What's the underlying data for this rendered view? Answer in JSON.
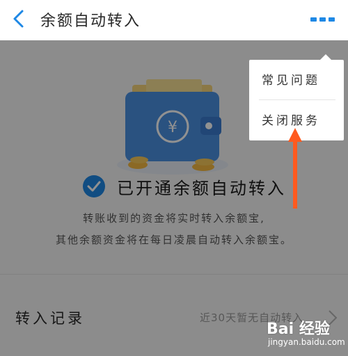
{
  "header": {
    "title": "余额自动转入",
    "back_icon": "chevron-left-icon",
    "more_icon": "more-dots-icon",
    "accent_color": "#1e88e5"
  },
  "main": {
    "status_text": "已开通余额自动转入",
    "desc_line1": "转账收到的资金将实时转入余额宝,",
    "desc_line2": "其他余额资金将在每日凌晨自动转入余额宝。",
    "record_label": "转入记录",
    "record_value": "近30天暂无自动转入"
  },
  "menu": {
    "items": [
      {
        "label": "常见问题"
      },
      {
        "label": "关闭服务"
      }
    ]
  },
  "annotation": {
    "arrow_color": "#ff5a1f"
  },
  "watermark": {
    "logo_text": "Bai  经验",
    "url": "jingyan.baidu.com"
  }
}
